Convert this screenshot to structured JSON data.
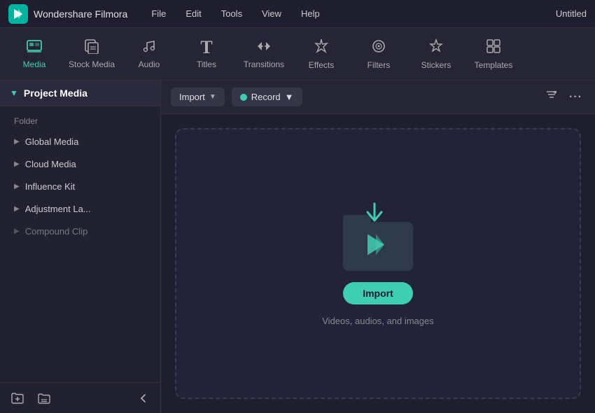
{
  "titlebar": {
    "app_name": "Wondershare Filmora",
    "menu_items": [
      "File",
      "Edit",
      "Tools",
      "View",
      "Help"
    ],
    "window_title": "Untitled"
  },
  "toolbar": {
    "items": [
      {
        "id": "media",
        "label": "Media",
        "icon": "🎞",
        "active": true
      },
      {
        "id": "stock_media",
        "label": "Stock Media",
        "icon": "📥",
        "active": false
      },
      {
        "id": "audio",
        "label": "Audio",
        "icon": "🎵",
        "active": false
      },
      {
        "id": "titles",
        "label": "Titles",
        "icon": "T",
        "active": false
      },
      {
        "id": "transitions",
        "label": "Transitions",
        "icon": "↔",
        "active": false
      },
      {
        "id": "effects",
        "label": "Effects",
        "icon": "✦",
        "active": false
      },
      {
        "id": "filters",
        "label": "Filters",
        "icon": "⊙",
        "active": false
      },
      {
        "id": "stickers",
        "label": "Stickers",
        "icon": "★",
        "active": false
      },
      {
        "id": "templates",
        "label": "Templates",
        "icon": "⊞",
        "active": false
      }
    ]
  },
  "sidebar": {
    "header_title": "Project Media",
    "folder_label": "Folder",
    "items": [
      {
        "id": "global_media",
        "label": "Global Media"
      },
      {
        "id": "cloud_media",
        "label": "Cloud Media"
      },
      {
        "id": "influence_kit",
        "label": "Influence Kit"
      },
      {
        "id": "adjustment_la",
        "label": "Adjustment La..."
      },
      {
        "id": "compound_clip",
        "label": "Compound Clip"
      }
    ],
    "footer": {
      "add_folder_btn": "🗁",
      "folder_btn": "🗀",
      "collapse_btn": "‹"
    }
  },
  "content": {
    "toolbar": {
      "import_label": "Import",
      "record_label": "Record"
    },
    "dropzone": {
      "import_btn_label": "Import",
      "description": "Videos, audios, and images"
    }
  }
}
